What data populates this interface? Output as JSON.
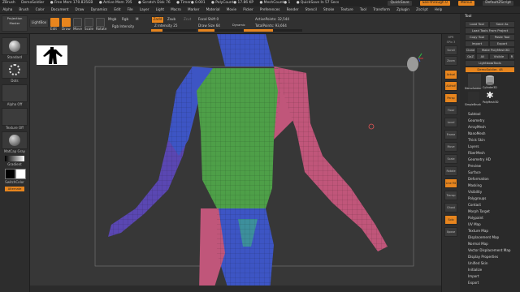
{
  "titlebar": {
    "app": "ZBrush",
    "items": [
      "DemoSoldier",
      "● Free Mem 170.835GB",
      "● Active Mem 705",
      "● Scratch Disk 76",
      "● Timer● 0.001",
      "● PolyCount● 17.86 KP",
      "● MeshCount● 1",
      "● QuickSave In 57 Secs"
    ],
    "quicksave": "QuickSave",
    "see_through": "See-through  0",
    "menus_btn": "Menus",
    "default_script": "DefaultZScript"
  },
  "menubar": [
    "Alpha",
    "Brush",
    "Color",
    "Document",
    "Draw",
    "Dynamics",
    "Edit",
    "File",
    "Layer",
    "Light",
    "Macro",
    "Marker",
    "Material",
    "Movie",
    "Picker",
    "Preferences",
    "Render",
    "Stencil",
    "Stroke",
    "Texture",
    "Tool",
    "Transform",
    "Zplugin",
    "Zscript",
    "Help"
  ],
  "toolbar": {
    "lightbox": "LightBox",
    "projection_master": "Projection Master",
    "edit": "Edit",
    "draw": "Draw",
    "move": "Move",
    "scale": "Scale",
    "rotate": "Rotate",
    "mrgb": "Mrgb",
    "rgb": "Rgb",
    "m": "M",
    "zadd": "Zadd",
    "zsub": "Zsub",
    "zcut": "Zcut",
    "rgb_intensity": "Rgb Intensity",
    "z_intensity": "Z Intensity 25",
    "focal_shift": "Focal Shift 0",
    "draw_size": "Draw Size 64",
    "dynamic": "Dynamic",
    "active_points": "ActivePoints: 32,544",
    "total_points": "TotalPoints: 93,664",
    "focal_fill": 0.5,
    "draw_fill": 0.35,
    "z_fill": 0.25
  },
  "leftshelf": {
    "brush": "Standard",
    "stroke": "Dots",
    "alpha": "Alpha Off",
    "texture": "Texture Off",
    "material": "MatCap Gray",
    "gradient": "Gradient",
    "switch_color": "SwitchColor",
    "alternate": "Alternate"
  },
  "rightbar": [
    "BPR",
    "SPix 3",
    "Scroll",
    "Zoom",
    "Actual",
    "AAHalf",
    "Persp",
    "Floor",
    "Local",
    "Frame",
    "Move",
    "Scale",
    "Rotate",
    "Line Fill PolyF",
    "Transp",
    "Ghost",
    "Solo",
    "Xpose"
  ],
  "tool": {
    "header": "Tool",
    "buttons": [
      "Load Tool",
      "Save As",
      "Load Tools From Project",
      "Copy Tool",
      "Paste Tool",
      "Import",
      "Export",
      "Clone",
      "Make PolyMesh3D",
      "GoZ",
      "All",
      "Visible",
      "R",
      "Lightbox▸Tools"
    ],
    "demosoldier_value": "DemoSoldier.  48",
    "thumbs": [
      "DemoSoldier",
      "Cylinder3D",
      "PolyMesh3D",
      "SimpleBrush",
      "DemoSoldier"
    ],
    "subpalettes": [
      "Subtool",
      "Geometry",
      "ArrayMesh",
      "NanoMesh",
      "Thick Skin",
      "Layers",
      "FiberMesh",
      "Geometry HD",
      "Preview",
      "Surface",
      "Deformation",
      "Masking",
      "Visibility",
      "Polygroups",
      "Contact",
      "Morph Target",
      "Polypaint",
      "UV Map",
      "Texture Map",
      "Displacement Map",
      "Normal Map",
      "Vector Displacement Map",
      "Display Properties",
      "Unified Skin",
      "Initialize",
      "Import",
      "Export"
    ]
  },
  "colors": {
    "accent": "#e7851e",
    "panel": "#2a2a2a",
    "canvas": "#373737",
    "group_blue": "#3d55c4",
    "group_green": "#4e9f48",
    "group_pink": "#c0567a",
    "group_purple": "#5a47b2",
    "group_teal": "#3d8f9c"
  }
}
